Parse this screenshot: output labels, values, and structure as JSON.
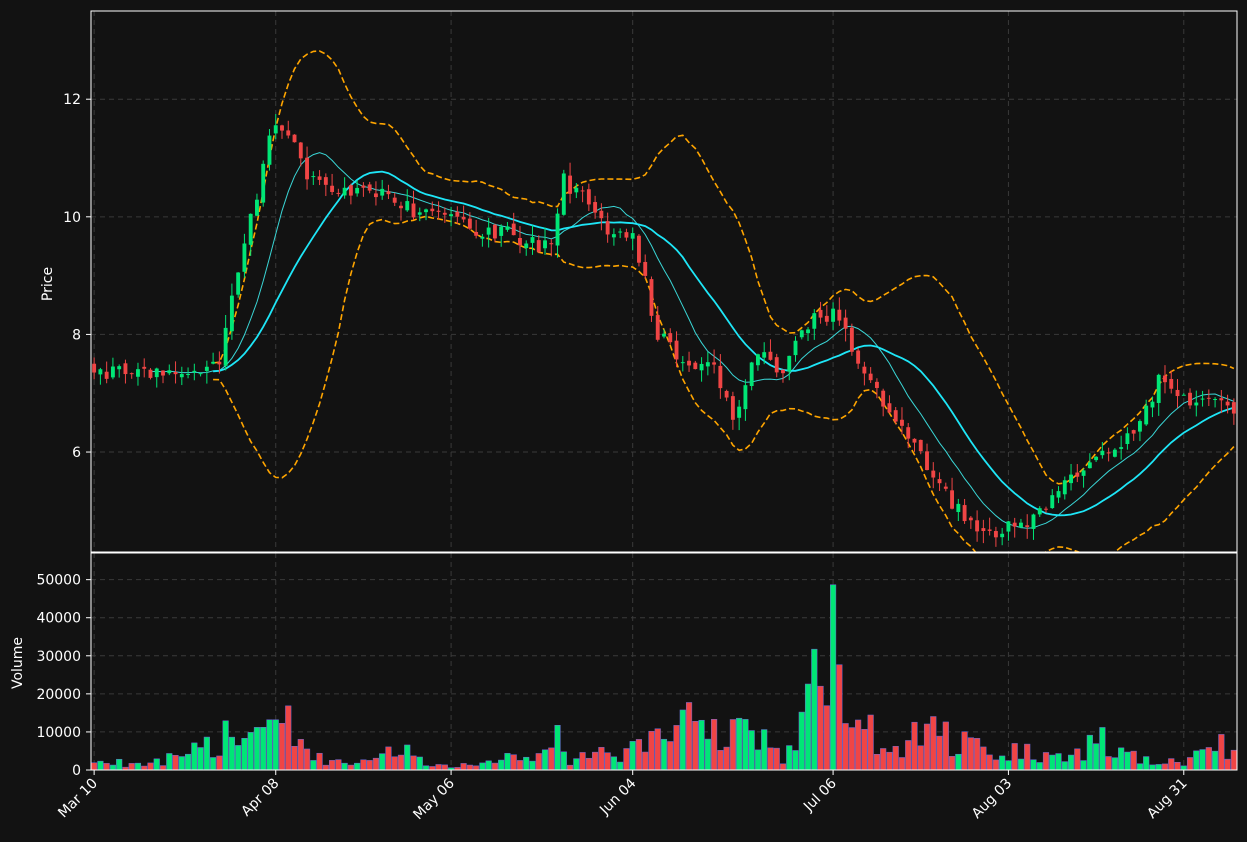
{
  "chart_data": {
    "type": "candlestick",
    "colors": {
      "background": "#121212",
      "up": "#00e676",
      "down": "#f04545",
      "ma_fast": "#3ad6d6",
      "ma_slow": "#1ee6f7",
      "band": "#ffa500",
      "grid": "#3a3a3a",
      "text": "#ffffff"
    },
    "price_panel": {
      "ylabel": "Price",
      "ylim": [
        4.3,
        13.5
      ],
      "yticks": [
        "6",
        "8",
        "10",
        "12"
      ],
      "grid": true
    },
    "volume_panel": {
      "ylabel": "Volume",
      "ylim": [
        0,
        57000
      ],
      "yticks": [
        "0",
        "10000",
        "20000",
        "30000",
        "40000",
        "50000"
      ],
      "grid": true
    },
    "x_ticks": [
      {
        "label": "Mar 10",
        "day": 0
      },
      {
        "label": "Apr 08",
        "day": 29
      },
      {
        "label": "May 06",
        "day": 57
      },
      {
        "label": "Jun 04",
        "day": 86
      },
      {
        "label": "Jul 06",
        "day": 118
      },
      {
        "label": "Aug 03",
        "day": 146
      },
      {
        "label": "Aug 31",
        "day": 174
      }
    ],
    "candle_series": {
      "start_date": "2024-03-10",
      "days": 183,
      "anchors": [
        [
          0,
          7.4
        ],
        [
          6,
          7.3
        ],
        [
          10,
          7.35
        ],
        [
          14,
          7.3
        ],
        [
          17,
          7.3
        ],
        [
          20,
          7.5
        ],
        [
          22,
          8.7
        ],
        [
          24,
          9.6
        ],
        [
          26,
          10.4
        ],
        [
          28,
          11.4
        ],
        [
          30,
          11.6
        ],
        [
          34,
          10.7
        ],
        [
          38,
          10.4
        ],
        [
          43,
          10.5
        ],
        [
          48,
          10.3
        ],
        [
          53,
          10.0
        ],
        [
          57,
          10.0
        ],
        [
          62,
          9.7
        ],
        [
          66,
          9.7
        ],
        [
          70,
          9.6
        ],
        [
          73,
          9.4
        ],
        [
          75,
          10.6
        ],
        [
          78,
          10.3
        ],
        [
          82,
          9.7
        ],
        [
          86,
          9.6
        ],
        [
          88,
          8.9
        ],
        [
          90,
          8.0
        ],
        [
          95,
          7.4
        ],
        [
          98,
          7.6
        ],
        [
          102,
          6.6
        ],
        [
          106,
          7.7
        ],
        [
          110,
          7.4
        ],
        [
          114,
          8.2
        ],
        [
          118,
          8.4
        ],
        [
          122,
          7.6
        ],
        [
          126,
          6.9
        ],
        [
          130,
          6.3
        ],
        [
          134,
          5.6
        ],
        [
          138,
          5.0
        ],
        [
          142,
          4.6
        ],
        [
          146,
          4.7
        ],
        [
          150,
          4.9
        ],
        [
          154,
          5.3
        ],
        [
          158,
          5.8
        ],
        [
          162,
          6.1
        ],
        [
          166,
          6.3
        ],
        [
          170,
          7.2
        ],
        [
          174,
          6.9
        ],
        [
          178,
          7.0
        ],
        [
          182,
          6.6
        ]
      ],
      "ma_fast_window": 10,
      "ma_slow_window": 20,
      "band_width_sd": 2
    },
    "volume_series": {
      "anchors": [
        [
          0,
          2000
        ],
        [
          8,
          2000
        ],
        [
          12,
          3000
        ],
        [
          16,
          5500
        ],
        [
          20,
          8000
        ],
        [
          24,
          12000
        ],
        [
          27,
          10000
        ],
        [
          30,
          14000
        ],
        [
          33,
          8000
        ],
        [
          37,
          3000
        ],
        [
          40,
          1500
        ],
        [
          45,
          2500
        ],
        [
          50,
          7000
        ],
        [
          54,
          1500
        ],
        [
          58,
          1500
        ],
        [
          62,
          1500
        ],
        [
          65,
          3000
        ],
        [
          70,
          4000
        ],
        [
          73,
          11000
        ],
        [
          76,
          2500
        ],
        [
          80,
          4000
        ],
        [
          84,
          5000
        ],
        [
          88,
          7000
        ],
        [
          92,
          11000
        ],
        [
          96,
          13000
        ],
        [
          100,
          10000
        ],
        [
          104,
          17000
        ],
        [
          108,
          5000
        ],
        [
          110,
          3000
        ],
        [
          112,
          6000
        ],
        [
          114,
          19500
        ],
        [
          116,
          35000
        ],
        [
          118,
          50000
        ],
        [
          120,
          20000
        ],
        [
          122,
          10000
        ],
        [
          126,
          10000
        ],
        [
          130,
          9000
        ],
        [
          134,
          10000
        ],
        [
          138,
          8000
        ],
        [
          142,
          5000
        ],
        [
          146,
          5000
        ],
        [
          150,
          5000
        ],
        [
          154,
          3500
        ],
        [
          158,
          6000
        ],
        [
          162,
          9000
        ],
        [
          166,
          5000
        ],
        [
          170,
          3000
        ],
        [
          174,
          3000
        ],
        [
          178,
          5000
        ],
        [
          182,
          8000
        ]
      ]
    }
  }
}
